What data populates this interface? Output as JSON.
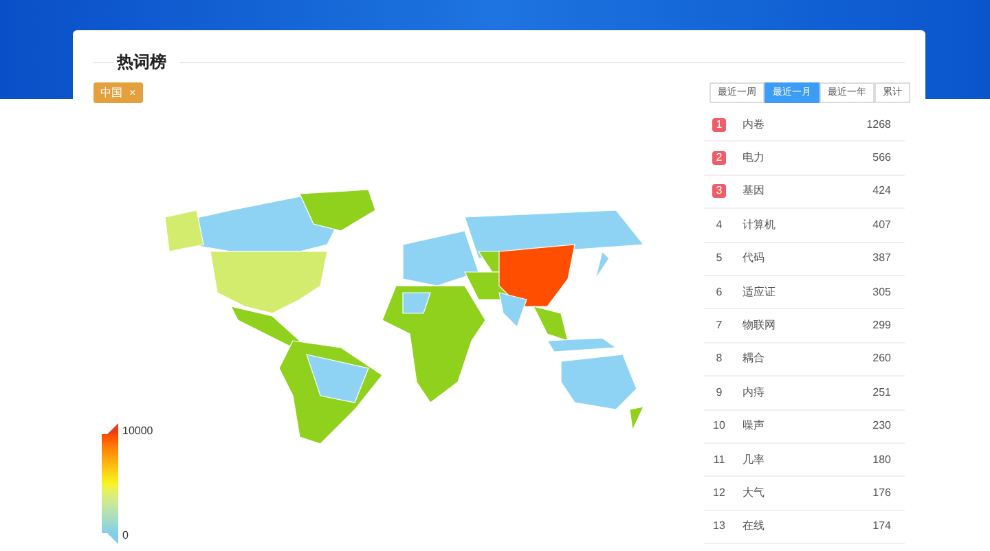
{
  "panel": {
    "title": "热词榜"
  },
  "filter_tag": {
    "label": "中国",
    "close": "×"
  },
  "tabs": [
    {
      "label": "最近一周",
      "selected": false
    },
    {
      "label": "最近一月",
      "selected": true
    },
    {
      "label": "最近一年",
      "selected": false
    },
    {
      "label": "累计",
      "selected": false
    }
  ],
  "legend": {
    "max": "10000",
    "min": "0"
  },
  "rows": [
    {
      "rank": "1",
      "term": "内卷",
      "count": "1268",
      "highlighted": true
    },
    {
      "rank": "2",
      "term": "电力",
      "count": "566",
      "highlighted": true
    },
    {
      "rank": "3",
      "term": "基因",
      "count": "424",
      "highlighted": true
    },
    {
      "rank": "4",
      "term": "计算机",
      "count": "407",
      "highlighted": false
    },
    {
      "rank": "5",
      "term": "代码",
      "count": "387",
      "highlighted": false
    },
    {
      "rank": "6",
      "term": "适应证",
      "count": "305",
      "highlighted": false
    },
    {
      "rank": "7",
      "term": "物联网",
      "count": "299",
      "highlighted": false
    },
    {
      "rank": "8",
      "term": "耦合",
      "count": "260",
      "highlighted": false
    },
    {
      "rank": "9",
      "term": "内痔",
      "count": "251",
      "highlighted": false
    },
    {
      "rank": "10",
      "term": "噪声",
      "count": "230",
      "highlighted": false
    },
    {
      "rank": "11",
      "term": "几率",
      "count": "180",
      "highlighted": false
    },
    {
      "rank": "12",
      "term": "大气",
      "count": "176",
      "highlighted": false
    },
    {
      "rank": "13",
      "term": "在线",
      "count": "174",
      "highlighted": false
    }
  ]
}
